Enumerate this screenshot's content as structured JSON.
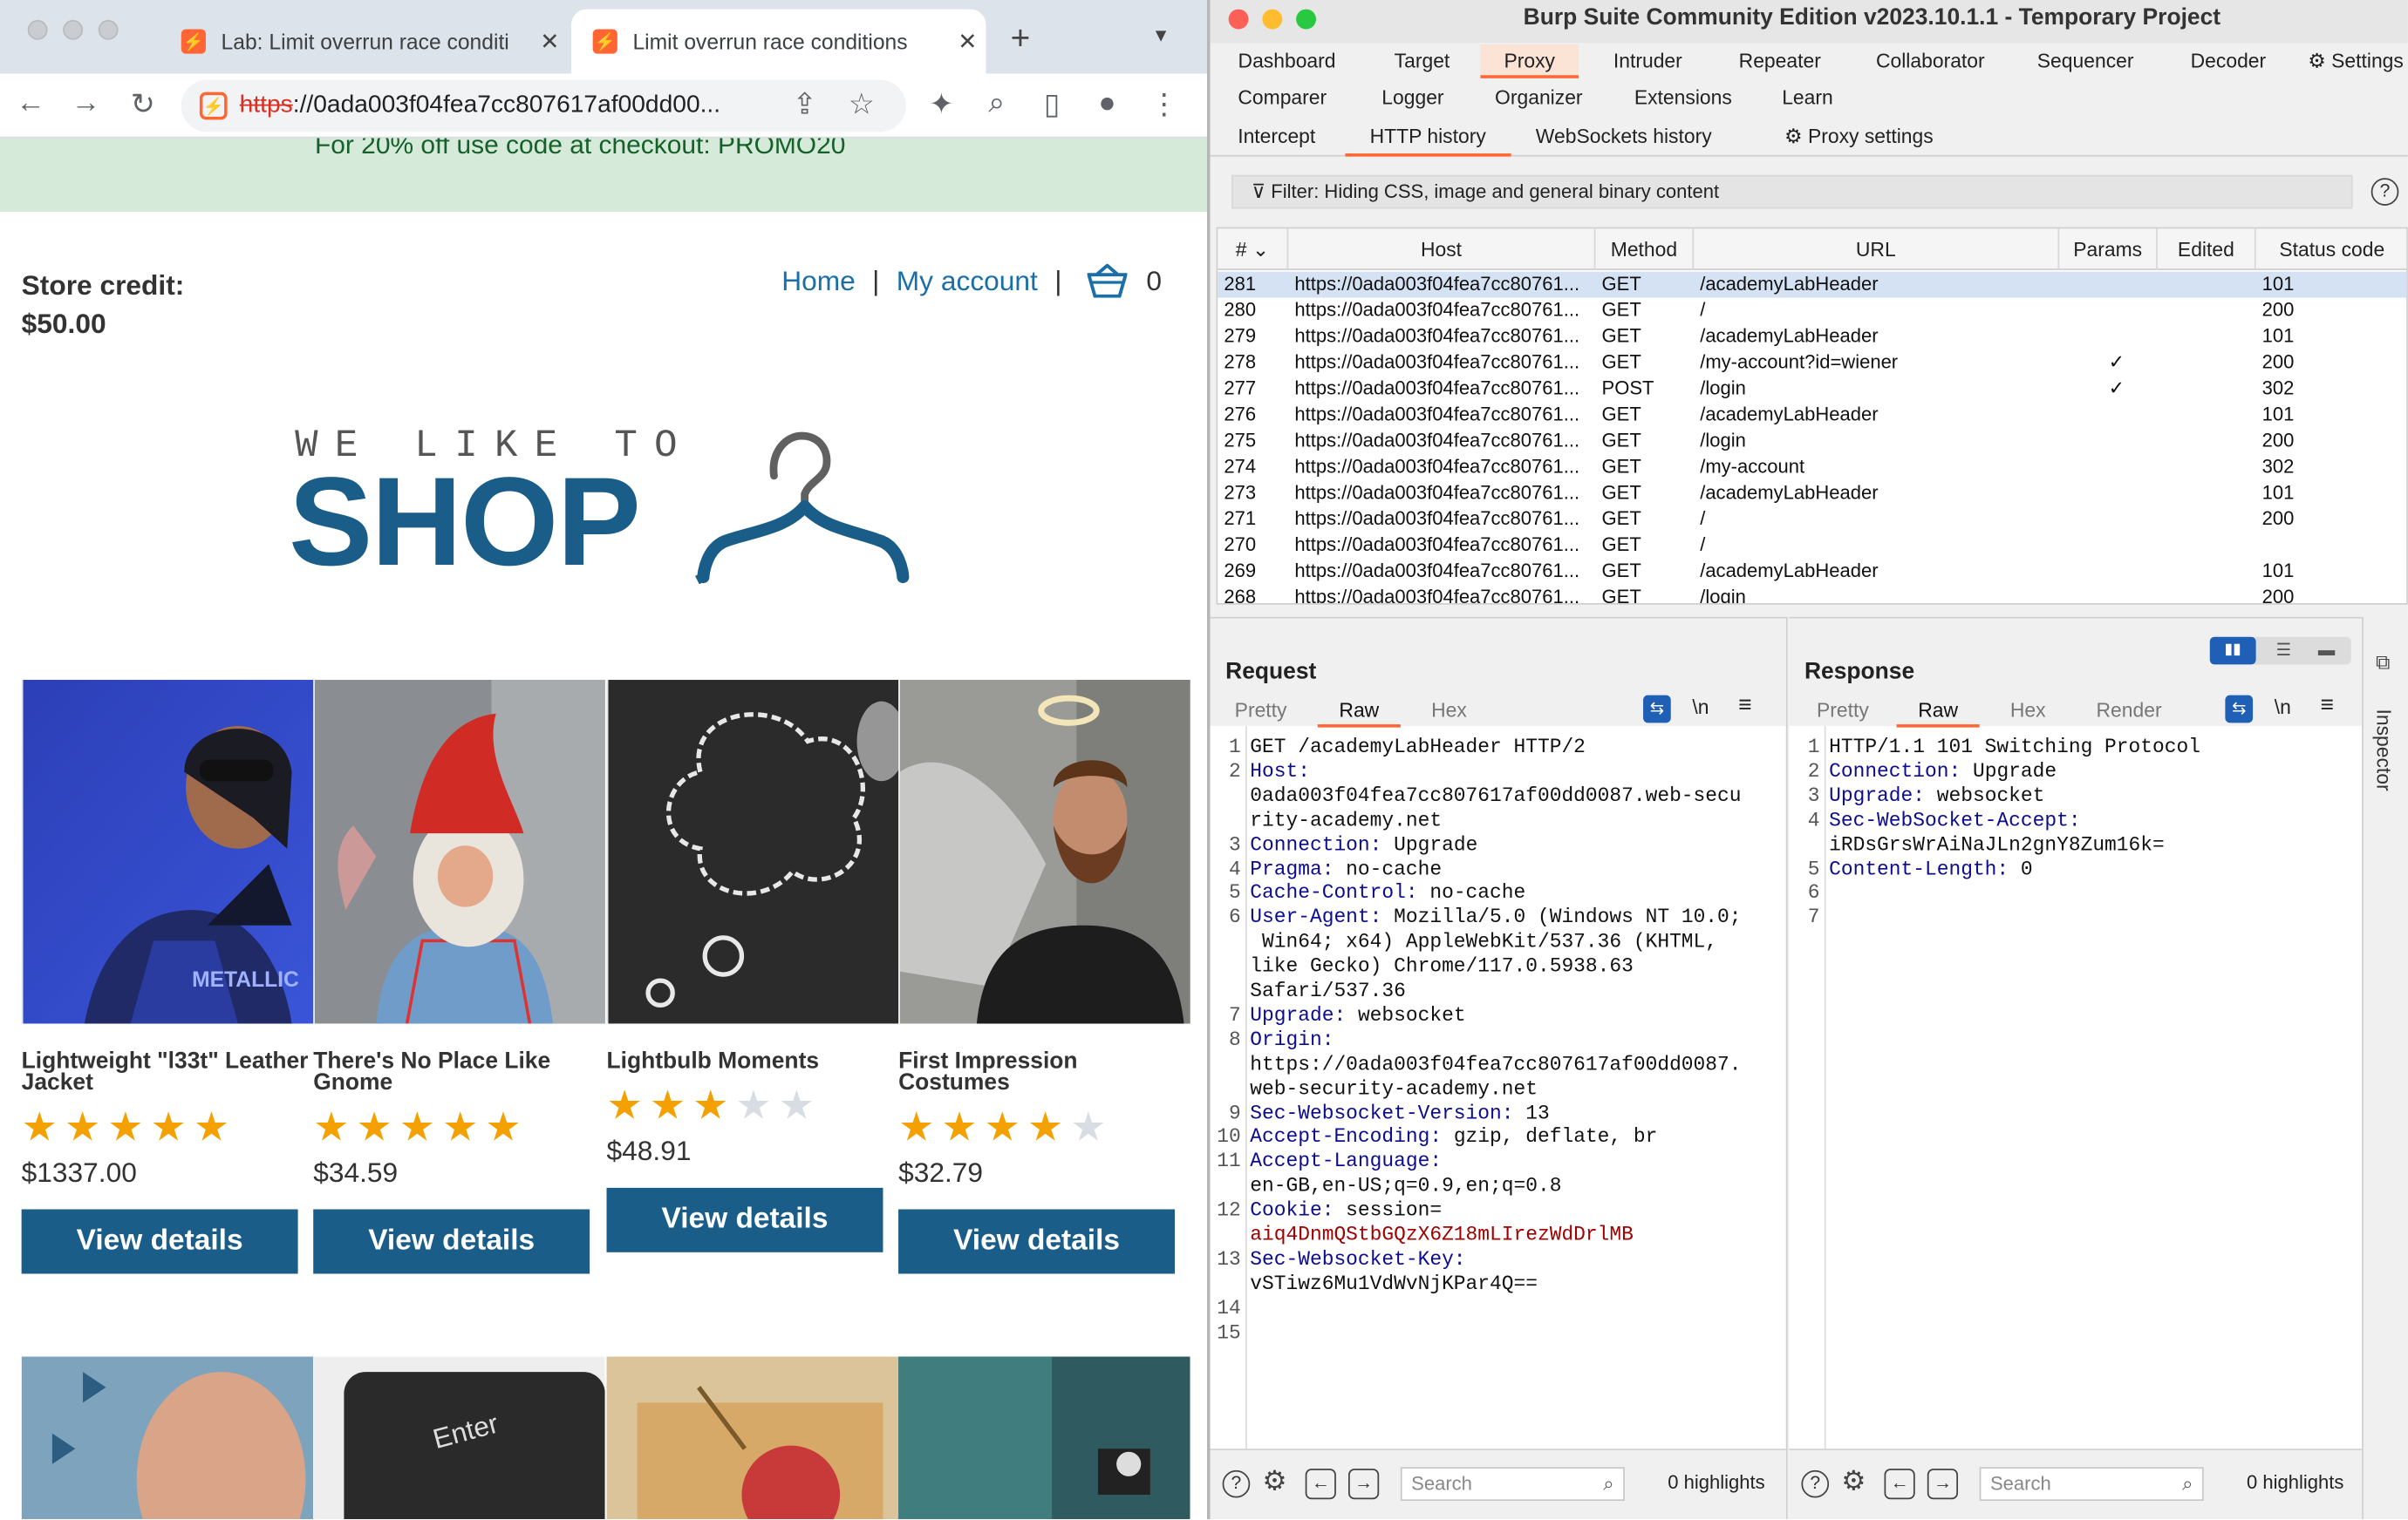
{
  "browser": {
    "tabs": [
      {
        "title": "Lab: Limit overrun race conditi",
        "active": false
      },
      {
        "title": "Limit overrun race conditions",
        "active": true
      }
    ],
    "new_tab": "+",
    "url_scheme": "https",
    "url_rest": "://0ada003f04fea7cc807617af00dd00..."
  },
  "shop": {
    "promo": "For 20% off use code at checkout: PROMO20",
    "credit_label": "Store credit:",
    "credit_value": "$50.00",
    "nav": {
      "home": "Home",
      "account": "My account",
      "cart_count": "0",
      "separator": "|"
    },
    "logo_top": "WE LIKE TO",
    "logo_main": "SHOP",
    "products": [
      {
        "name": "Lightweight \"l33t\" Leather Jacket",
        "rating": 5,
        "price": "$1337.00",
        "button": "View details"
      },
      {
        "name": "There's No Place Like Gnome",
        "rating": 5,
        "price": "$34.59",
        "button": "View details"
      },
      {
        "name": "Lightbulb Moments",
        "rating": 3,
        "price": "$48.91",
        "button": "View details"
      },
      {
        "name": "First Impression Costumes",
        "rating": 4,
        "price": "$32.79",
        "button": "View details"
      }
    ]
  },
  "burp": {
    "title": "Burp Suite Community Edition v2023.10.1.1 - Temporary Project",
    "menu_row1": [
      "Dashboard",
      "Target",
      "Proxy",
      "Intruder",
      "Repeater",
      "Collaborator",
      "Sequencer",
      "Decoder",
      "Settings"
    ],
    "menu_row2": [
      "Comparer",
      "Logger",
      "Organizer",
      "Extensions",
      "Learn"
    ],
    "selected_menu": "Proxy",
    "subtabs": [
      "Intercept",
      "HTTP history",
      "WebSockets history",
      "Proxy settings"
    ],
    "selected_subtab": "HTTP history",
    "filter": "Filter: Hiding CSS, image and general binary content",
    "columns": [
      "#",
      "Host",
      "Method",
      "URL",
      "Params",
      "Edited",
      "Status code"
    ],
    "rows": [
      {
        "num": "281",
        "host": "https://0ada003f04fea7cc80761...",
        "method": "GET",
        "url": "/academyLabHeader",
        "params": "",
        "status": "101",
        "selected": true
      },
      {
        "num": "280",
        "host": "https://0ada003f04fea7cc80761...",
        "method": "GET",
        "url": "/",
        "params": "",
        "status": "200"
      },
      {
        "num": "279",
        "host": "https://0ada003f04fea7cc80761...",
        "method": "GET",
        "url": "/academyLabHeader",
        "params": "",
        "status": "101"
      },
      {
        "num": "278",
        "host": "https://0ada003f04fea7cc80761...",
        "method": "GET",
        "url": "/my-account?id=wiener",
        "params": "✓",
        "status": "200"
      },
      {
        "num": "277",
        "host": "https://0ada003f04fea7cc80761...",
        "method": "POST",
        "url": "/login",
        "params": "✓",
        "status": "302"
      },
      {
        "num": "276",
        "host": "https://0ada003f04fea7cc80761...",
        "method": "GET",
        "url": "/academyLabHeader",
        "params": "",
        "status": "101"
      },
      {
        "num": "275",
        "host": "https://0ada003f04fea7cc80761...",
        "method": "GET",
        "url": "/login",
        "params": "",
        "status": "200"
      },
      {
        "num": "274",
        "host": "https://0ada003f04fea7cc80761...",
        "method": "GET",
        "url": "/my-account",
        "params": "",
        "status": "302"
      },
      {
        "num": "273",
        "host": "https://0ada003f04fea7cc80761...",
        "method": "GET",
        "url": "/academyLabHeader",
        "params": "",
        "status": "101"
      },
      {
        "num": "271",
        "host": "https://0ada003f04fea7cc80761...",
        "method": "GET",
        "url": "/",
        "params": "",
        "status": "200"
      },
      {
        "num": "270",
        "host": "https://0ada003f04fea7cc80761...",
        "method": "GET",
        "url": "/",
        "params": "",
        "status": ""
      },
      {
        "num": "269",
        "host": "https://0ada003f04fea7cc80761...",
        "method": "GET",
        "url": "/academyLabHeader",
        "params": "",
        "status": "101"
      },
      {
        "num": "268",
        "host": "https://0ada003f04fea7cc80761...",
        "method": "GET",
        "url": "/login",
        "params": "",
        "status": "200"
      }
    ],
    "request": {
      "title": "Request",
      "tabs": [
        "Pretty",
        "Raw",
        "Hex"
      ],
      "selected_tab": "Raw",
      "lines": [
        {
          "n": "1",
          "k": "",
          "v": "GET /academyLabHeader HTTP/2"
        },
        {
          "n": "2",
          "k": "Host:",
          "v": ""
        },
        {
          "n": "",
          "k": "",
          "v": "0ada003f04fea7cc807617af00dd0087.web-secu"
        },
        {
          "n": "",
          "k": "",
          "v": "rity-academy.net"
        },
        {
          "n": "3",
          "k": "Connection:",
          "v": " Upgrade"
        },
        {
          "n": "4",
          "k": "Pragma:",
          "v": " no-cache"
        },
        {
          "n": "5",
          "k": "Cache-Control:",
          "v": " no-cache"
        },
        {
          "n": "6",
          "k": "User-Agent:",
          "v": " Mozilla/5.0 (Windows NT 10.0;"
        },
        {
          "n": "",
          "k": "",
          "v": " Win64; x64) AppleWebKit/537.36 (KHTML,"
        },
        {
          "n": "",
          "k": "",
          "v": "like Gecko) Chrome/117.0.5938.63"
        },
        {
          "n": "",
          "k": "",
          "v": "Safari/537.36"
        },
        {
          "n": "7",
          "k": "Upgrade:",
          "v": " websocket"
        },
        {
          "n": "8",
          "k": "Origin:",
          "v": ""
        },
        {
          "n": "",
          "k": "",
          "v": "https://0ada003f04fea7cc807617af00dd0087."
        },
        {
          "n": "",
          "k": "",
          "v": "web-security-academy.net"
        },
        {
          "n": "9",
          "k": "Sec-Websocket-Version:",
          "v": " 13"
        },
        {
          "n": "10",
          "k": "Accept-Encoding:",
          "v": " gzip, deflate, br"
        },
        {
          "n": "11",
          "k": "Accept-Language:",
          "v": ""
        },
        {
          "n": "",
          "k": "",
          "v": "en-GB,en-US;q=0.9,en;q=0.8"
        },
        {
          "n": "12",
          "k": "Cookie:",
          "v": " session="
        },
        {
          "n": "",
          "k": "",
          "v": "aiq4DnmQStbGQzX6Z18mLIrezWdDrlMB",
          "red": true
        },
        {
          "n": "13",
          "k": "Sec-Websocket-Key:",
          "v": ""
        },
        {
          "n": "",
          "k": "",
          "v": "vSTiwz6Mu1VdWvNjKPar4Q=="
        },
        {
          "n": "14",
          "k": "",
          "v": ""
        },
        {
          "n": "15",
          "k": "",
          "v": ""
        }
      ]
    },
    "response": {
      "title": "Response",
      "tabs": [
        "Pretty",
        "Raw",
        "Hex",
        "Render"
      ],
      "selected_tab": "Raw",
      "lines": [
        {
          "n": "1",
          "k": "",
          "v": "HTTP/1.1 101 Switching Protocol"
        },
        {
          "n": "2",
          "k": "Connection:",
          "v": " Upgrade"
        },
        {
          "n": "3",
          "k": "Upgrade:",
          "v": " websocket"
        },
        {
          "n": "4",
          "k": "Sec-WebSocket-Accept:",
          "v": ""
        },
        {
          "n": "",
          "k": "",
          "v": "iRDsGrsWrAiNaJLn2gnY8Zum16k="
        },
        {
          "n": "5",
          "k": "Content-Length:",
          "v": " 0"
        },
        {
          "n": "6",
          "k": "",
          "v": ""
        },
        {
          "n": "7",
          "k": "",
          "v": ""
        }
      ]
    },
    "footer": {
      "search_placeholder": "Search",
      "highlights": "0 highlights"
    },
    "inspector": "Inspector"
  }
}
